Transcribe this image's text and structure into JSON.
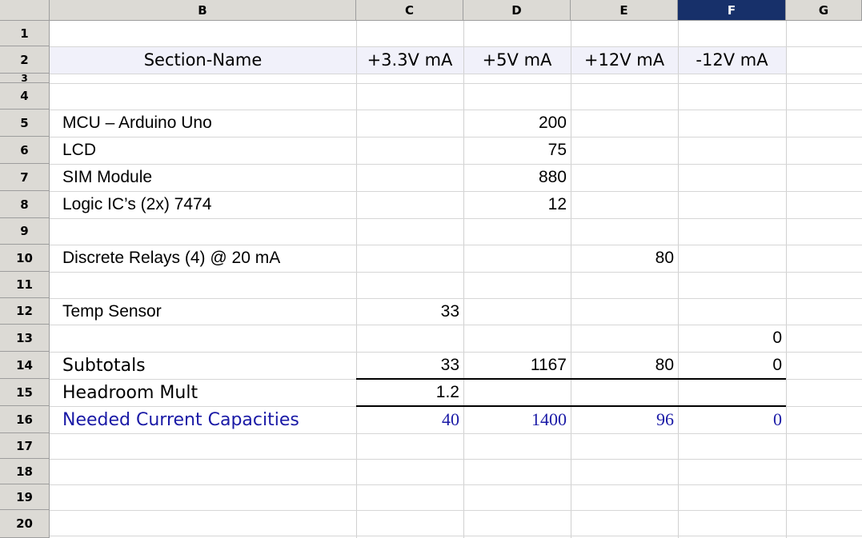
{
  "sheet": {
    "columns": [
      "B",
      "C",
      "D",
      "E",
      "F",
      "G"
    ],
    "selected_column": "F",
    "rows": [
      "1",
      "2",
      "3",
      "4",
      "5",
      "6",
      "7",
      "8",
      "9",
      "10",
      "11",
      "12",
      "13",
      "14",
      "15",
      "16",
      "17",
      "18",
      "19",
      "20"
    ]
  },
  "header_row": {
    "section_name": "Section-Name",
    "col_3v3": "+3.3V mA",
    "col_5v": "+5V mA",
    "col_12v": "+12V mA",
    "col_neg12v": "-12V mA"
  },
  "items": [
    {
      "name": "MCU – Arduino Uno",
      "v5": "200"
    },
    {
      "name": "LCD",
      "v5": "75"
    },
    {
      "name": "SIM Module",
      "v5": "880"
    },
    {
      "name": "Logic IC’s (2x) 7474",
      "v5": "12"
    },
    {
      "name": "Discrete Relays (4) @ 20 mA",
      "v12": "80"
    },
    {
      "name": "Temp Sensor",
      "v3": "33"
    }
  ],
  "row13": {
    "vneg12": "0"
  },
  "subtotals": {
    "label": "Subtotals",
    "v3": "33",
    "v5": "1167",
    "v12": "80",
    "vneg12": "0"
  },
  "headroom": {
    "label": "Headroom Mult",
    "value": "1.2"
  },
  "needed": {
    "label": "Needed Current Capacities",
    "v3": "40",
    "v5": "1400",
    "v12": "96",
    "vneg12": "0"
  },
  "colors": {
    "header_bg": "#dcdad5",
    "selected_header": "#17306a",
    "blue_text": "#1a1aa6"
  }
}
